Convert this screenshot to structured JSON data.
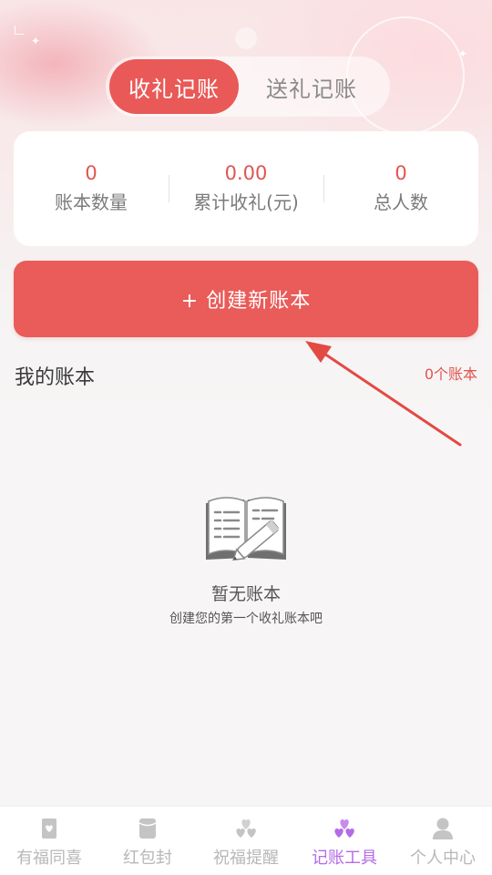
{
  "tabs": {
    "receive_label": "收礼记账",
    "send_label": "送礼记账",
    "active": "receive"
  },
  "stats": [
    {
      "value": "0",
      "label": "账本数量"
    },
    {
      "value": "0.00",
      "label": "累计收礼(元)"
    },
    {
      "value": "0",
      "label": "总人数"
    }
  ],
  "create_button": {
    "label": "+ 创建新账本"
  },
  "section": {
    "title": "我的账本",
    "count": "0个账本"
  },
  "empty_state": {
    "title": "暂无账本",
    "subtitle": "创建您的第一个收礼账本吧",
    "icon": "notebook-pencil-icon"
  },
  "bottom_nav": [
    {
      "label": "有福同喜",
      "icon": "card-heart-icon",
      "active": false
    },
    {
      "label": "红包封",
      "icon": "envelope-icon",
      "active": false
    },
    {
      "label": "祝福提醒",
      "icon": "hearts-icon",
      "active": false
    },
    {
      "label": "记账工具",
      "icon": "hearts-icon",
      "active": true
    },
    {
      "label": "个人中心",
      "icon": "person-icon",
      "active": false
    }
  ],
  "colors": {
    "accent": "#e95957",
    "nav_active": "#b46be8",
    "nav_inactive": "#b8b8b8"
  }
}
